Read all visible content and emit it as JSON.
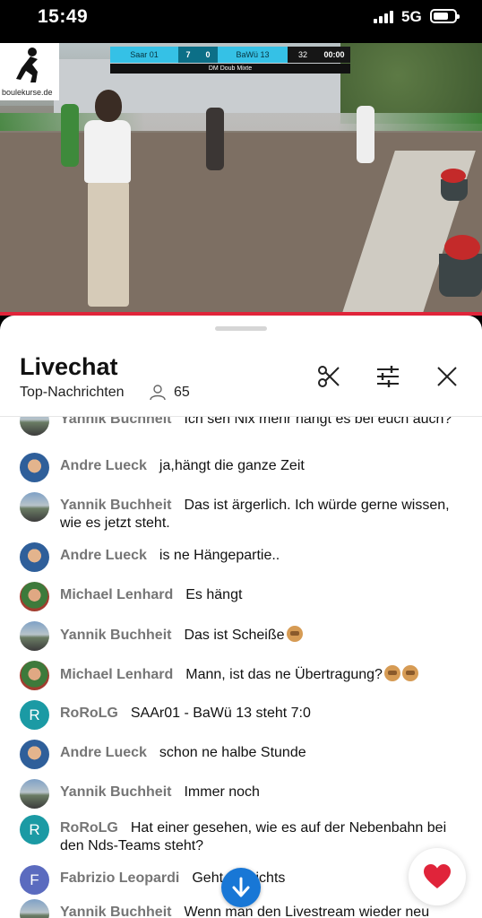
{
  "status_bar": {
    "time": "15:49",
    "network": "5G"
  },
  "video": {
    "logo_text": "boulekurse.de",
    "scoreboard": {
      "team1": "Saar 01",
      "score1": "7",
      "score2": "0",
      "team2": "BaWü 13",
      "points": "32",
      "timer": "00:00",
      "subtitle": "DM Doub Mixte"
    },
    "progress_fraction": 1.0
  },
  "chat": {
    "title": "Livechat",
    "subtitle": "Top-Nachrichten",
    "viewer_count": "65",
    "header_icons": [
      "scissors-icon",
      "sliders-icon",
      "close-icon"
    ],
    "messages": [
      {
        "author": "Yannik Buchheit",
        "text": "Ich seh Nix mehr hängt es bei euch auch?",
        "avatar": "photo-y"
      },
      {
        "author": "Andre Lueck",
        "text": "ja,hängt die ganze Zeit",
        "avatar": "photo-a"
      },
      {
        "author": "Yannik Buchheit",
        "text": "Das ist ärgerlich. Ich würde gerne wissen, wie es jetzt steht.",
        "avatar": "photo-y"
      },
      {
        "author": "Andre Lueck",
        "text": "is ne Hängepartie..",
        "avatar": "photo-a"
      },
      {
        "author": "Michael Lenhard",
        "text": "Es hängt",
        "avatar": "photo-m"
      },
      {
        "author": "Yannik Buchheit",
        "text": "Das ist Scheiße",
        "avatar": "photo-y",
        "emoji_count": 1
      },
      {
        "author": "Michael Lenhard",
        "text": "Mann, ist das ne Übertragung?",
        "avatar": "photo-m",
        "emoji_count": 2
      },
      {
        "author": "RoRoLG",
        "text": "SAAr01 - BaWü 13 steht 7:0",
        "avatar": "R"
      },
      {
        "author": "Andre Lueck",
        "text": "schon ne halbe Stunde",
        "avatar": "photo-a"
      },
      {
        "author": "Yannik Buchheit",
        "text": "Immer noch",
        "avatar": "photo-y"
      },
      {
        "author": "RoRoLG",
        "text": "Hat einer gesehen, wie es auf der Nebenbahn bei den Nds-Teams steht?",
        "avatar": "R"
      },
      {
        "author": "Fabrizio Leopardi",
        "text": "Geht garnichts",
        "avatar": "F"
      },
      {
        "author": "Yannik Buchheit",
        "text": "Wenn man den Livestream wieder neu",
        "avatar": "photo-y"
      }
    ],
    "scroll_down_icon": "arrow-down-icon",
    "reaction_icon": "heart-icon",
    "colors": {
      "accent": "#1877d6",
      "heart": "#e0243a",
      "progress": "#e0243a",
      "author": "#757575"
    }
  }
}
